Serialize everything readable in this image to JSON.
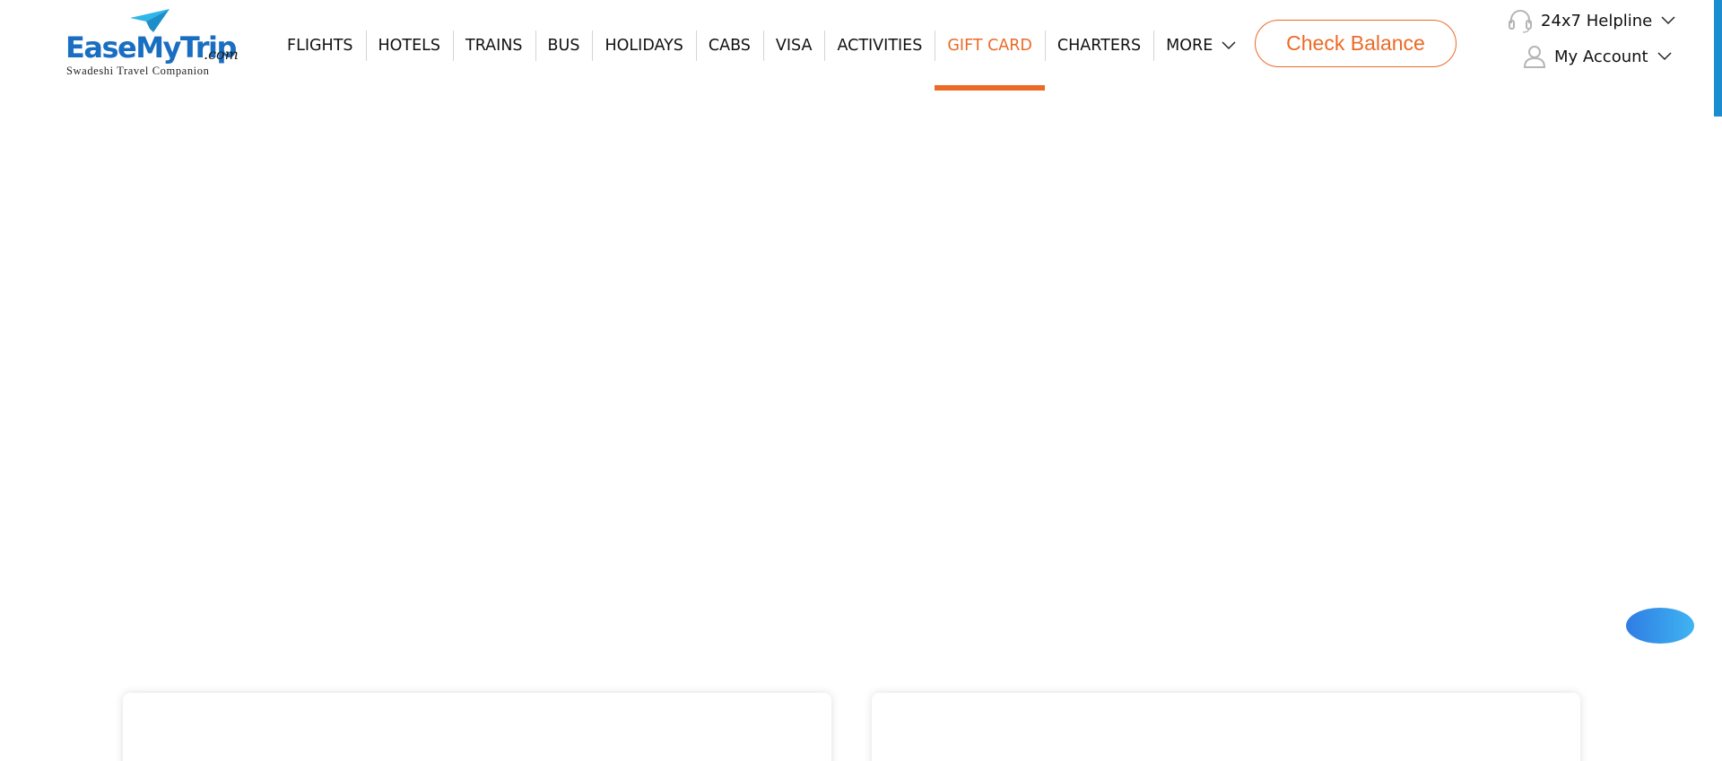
{
  "brand": {
    "name": "EaseMyTrip",
    "suffix": ".com",
    "tagline": "Swadeshi Travel Companion",
    "color": "#1a6ec1",
    "plane_icon": "paper-plane-icon"
  },
  "nav": {
    "items": [
      {
        "label": "FLIGHTS"
      },
      {
        "label": "HOTELS"
      },
      {
        "label": "TRAINS"
      },
      {
        "label": "BUS"
      },
      {
        "label": "HOLIDAYS"
      },
      {
        "label": "CABS"
      },
      {
        "label": "VISA"
      },
      {
        "label": "ACTIVITIES"
      },
      {
        "label": "GIFT CARD",
        "active": true
      },
      {
        "label": "CHARTERS"
      },
      {
        "label": "MORE",
        "icon": "chevron-down-icon"
      }
    ],
    "active_color": "#ec6a26"
  },
  "header_actions": {
    "check_balance_label": "Check Balance",
    "helpline_label": "24x7 Helpline",
    "helpline_icon": "headset-icon",
    "account_label": "My Account",
    "account_icon": "user-icon"
  },
  "chat": {
    "icon": "chat-bubble-icon",
    "color": "#3a8fe8"
  }
}
